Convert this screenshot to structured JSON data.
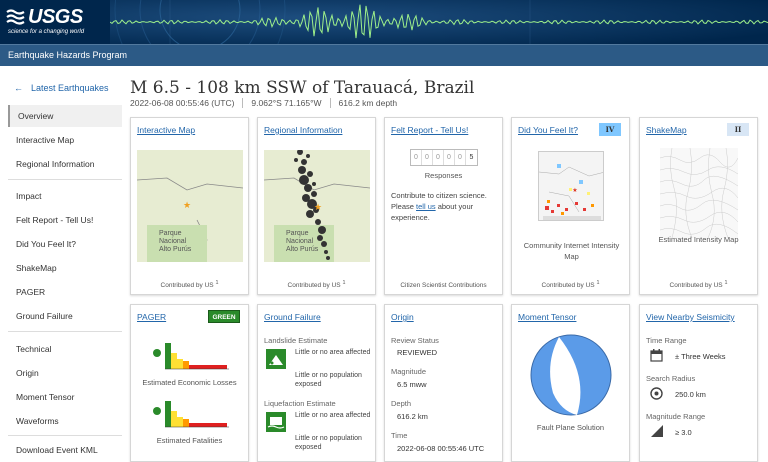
{
  "header": {
    "logo_text": "USGS",
    "logo_tagline": "science for a changing world",
    "program": "Earthquake Hazards Program"
  },
  "sidebar": {
    "latest": "Latest Earthquakes",
    "items": [
      {
        "label": "Overview",
        "active": true
      },
      {
        "label": "Interactive Map"
      },
      {
        "label": "Regional Information"
      },
      {
        "label": "Impact"
      },
      {
        "label": "Felt Report - Tell Us!"
      },
      {
        "label": "Did You Feel It?"
      },
      {
        "label": "ShakeMap"
      },
      {
        "label": "PAGER"
      },
      {
        "label": "Ground Failure"
      },
      {
        "label": "Technical"
      },
      {
        "label": "Origin"
      },
      {
        "label": "Moment Tensor"
      },
      {
        "label": "Waveforms"
      },
      {
        "label": "Download Event KML"
      }
    ]
  },
  "event": {
    "title": "M 6.5 - 108 km SSW of Tarauacá, Brazil",
    "time": "2022-06-08 00:55:46 (UTC)",
    "location": "9.062°S 71.165°W",
    "depth": "616.2 km depth"
  },
  "cards": {
    "interactive_map": {
      "title": "Interactive Map",
      "park": "Parque\nNacional\nAlto Purús",
      "footer": "Contributed by US",
      "footnote": "1"
    },
    "regional": {
      "title": "Regional Information",
      "park": "Parque\nNacional\nAlto Purús",
      "footer": "Contributed by US",
      "footnote": "1"
    },
    "felt": {
      "title": "Felt Report - Tell Us!",
      "digits": [
        "0",
        "0",
        "0",
        "0",
        "0",
        "5"
      ],
      "responses": "Responses",
      "text1": "Contribute to citizen science. Please ",
      "link": "tell us",
      "text2": " about your experience.",
      "footer": "Citizen Scientist Contributions"
    },
    "dyfi": {
      "title": "Did You Feel It?",
      "badge": "IV",
      "caption": "Community Internet Intensity Map",
      "footer": "Contributed by US",
      "footnote": "1"
    },
    "shakemap": {
      "title": "ShakeMap",
      "badge": "II",
      "caption": "Estimated Intensity Map",
      "footer": "Contributed by US",
      "footnote": "1"
    },
    "pager": {
      "title": "PAGER",
      "badge": "GREEN",
      "cap1": "Estimated Economic Losses",
      "cap2": "Estimated Fatalities"
    },
    "ground": {
      "title": "Ground Failure",
      "landslide": "Landslide Estimate",
      "ls_area": "Little or no area affected",
      "ls_pop": "Little or no population exposed",
      "liquefaction": "Liquefaction Estimate",
      "lq_area": "Little or no area affected",
      "lq_pop": "Little or no population exposed"
    },
    "origin": {
      "title": "Origin",
      "status_lbl": "Review Status",
      "status": "REVIEWED",
      "mag_lbl": "Magnitude",
      "mag": "6.5 mww",
      "depth_lbl": "Depth",
      "depth": "616.2 km",
      "time_lbl": "Time",
      "time": "2022-06-08 00:55:46 UTC"
    },
    "moment": {
      "title": "Moment Tensor",
      "caption": "Fault Plane Solution"
    },
    "nearby": {
      "title": "View Nearby Seismicity",
      "range_lbl": "Time Range",
      "range": "± Three Weeks",
      "radius_lbl": "Search Radius",
      "radius": "250.0 km",
      "magrange_lbl": "Magnitude Range",
      "magrange": "≥ 3.0"
    }
  },
  "colors": {
    "header_bg": "#00264c",
    "subbar_bg": "#2c5a86",
    "link": "#2266aa",
    "pager_green": "#2a8a2a",
    "beachball": "#5b9be8"
  }
}
